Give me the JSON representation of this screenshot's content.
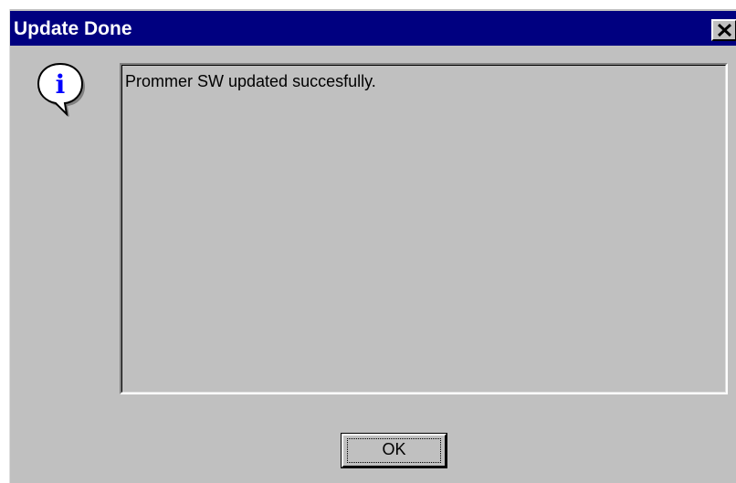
{
  "window": {
    "title": "Update Done",
    "close_icon": "close-icon"
  },
  "icon": {
    "name": "info-icon",
    "glyph": "i"
  },
  "message": {
    "text": "Prommer SW updated succesfully."
  },
  "buttons": {
    "ok_label": "OK"
  },
  "colors": {
    "titlebar": "#000080",
    "face": "#c0c0c0",
    "icon_accent": "#0000ff"
  }
}
